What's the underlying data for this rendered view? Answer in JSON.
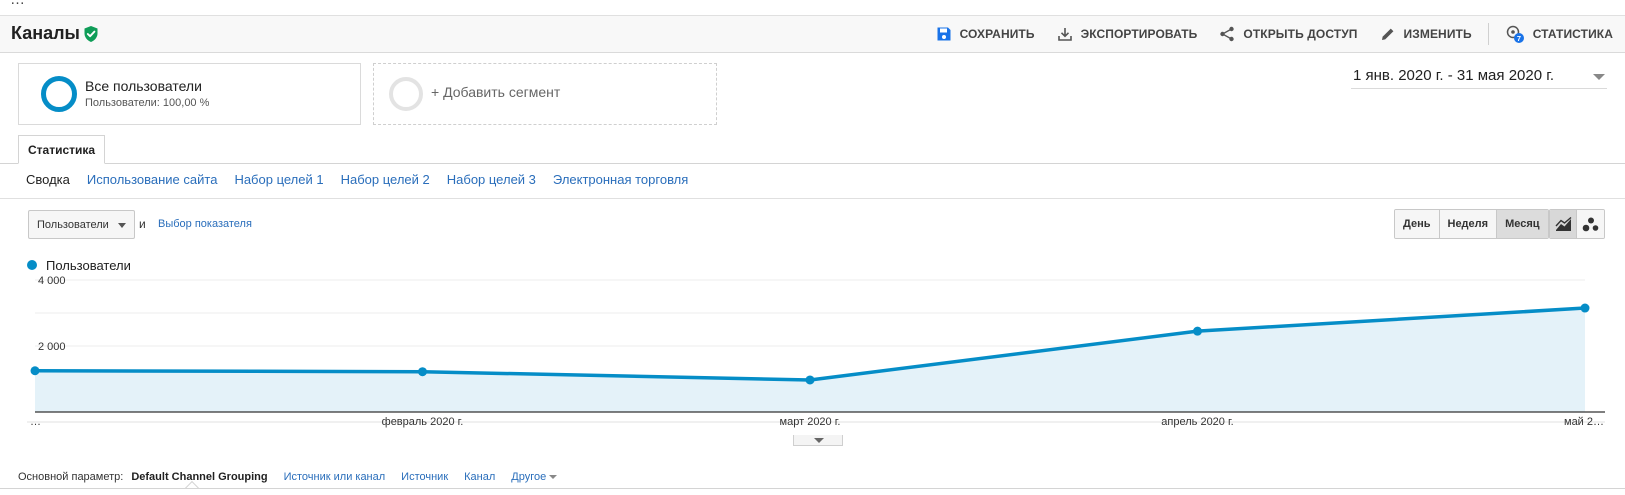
{
  "colors": {
    "accent": "#058dc7",
    "area_fill": "#e4f2f9",
    "link": "#2a6ebb",
    "verified": "#0f9d58"
  },
  "top_strip": {
    "text": "…"
  },
  "header": {
    "title": "Каналы",
    "actions": [
      {
        "label": "СОХРАНИТЬ",
        "icon": "save-icon"
      },
      {
        "label": "ЭКСПОРТИРОВАТЬ",
        "icon": "download-icon"
      },
      {
        "label": "ОТКРЫТЬ ДОСТУП",
        "icon": "share-icon"
      },
      {
        "label": "ИЗМЕНИТЬ",
        "icon": "pencil-icon"
      },
      {
        "label": "СТАТИСТИКА",
        "icon": "insights-icon",
        "badge": "7"
      }
    ]
  },
  "segments": {
    "current": {
      "name": "Все пользователи",
      "sub": "Пользователи: 100,00 %"
    },
    "add_label": "+ Добавить сегмент"
  },
  "date_range": "1 янв. 2020 г. - 31 мая 2020 г.",
  "tab": {
    "label": "Статистика"
  },
  "subnav": [
    "Сводка",
    "Использование сайта",
    "Набор целей 1",
    "Набор целей 2",
    "Набор целей 3",
    "Электронная торговля"
  ],
  "metric_selector": {
    "value": "Пользователи",
    "and": "и",
    "pick": "Выбор показателя"
  },
  "period": {
    "options": [
      "День",
      "Неделя",
      "Месяц"
    ],
    "active": "Месяц"
  },
  "view_toggle": {
    "icons": [
      "line-chart-icon",
      "motion-chart-icon"
    ]
  },
  "legend": {
    "label": "Пользователи"
  },
  "chart_data": {
    "type": "area",
    "series": [
      {
        "name": "Пользователи",
        "values": [
          1250,
          1220,
          970,
          2450,
          3150
        ]
      }
    ],
    "x_tick_labels": [
      "…",
      "февраль 2020 г.",
      "март 2020 г.",
      "апрель 2020 г.",
      "май 2…"
    ],
    "y_ticks": [
      2000,
      4000
    ],
    "y_tick_labels": [
      "2 000",
      "4 000"
    ],
    "ylim": [
      0,
      4000
    ],
    "grid": true
  },
  "dimension_bar": {
    "label": "Основной параметр:",
    "current": "Default Channel Grouping",
    "links": [
      "Источник или канал",
      "Источник",
      "Канал",
      "Другое"
    ]
  }
}
